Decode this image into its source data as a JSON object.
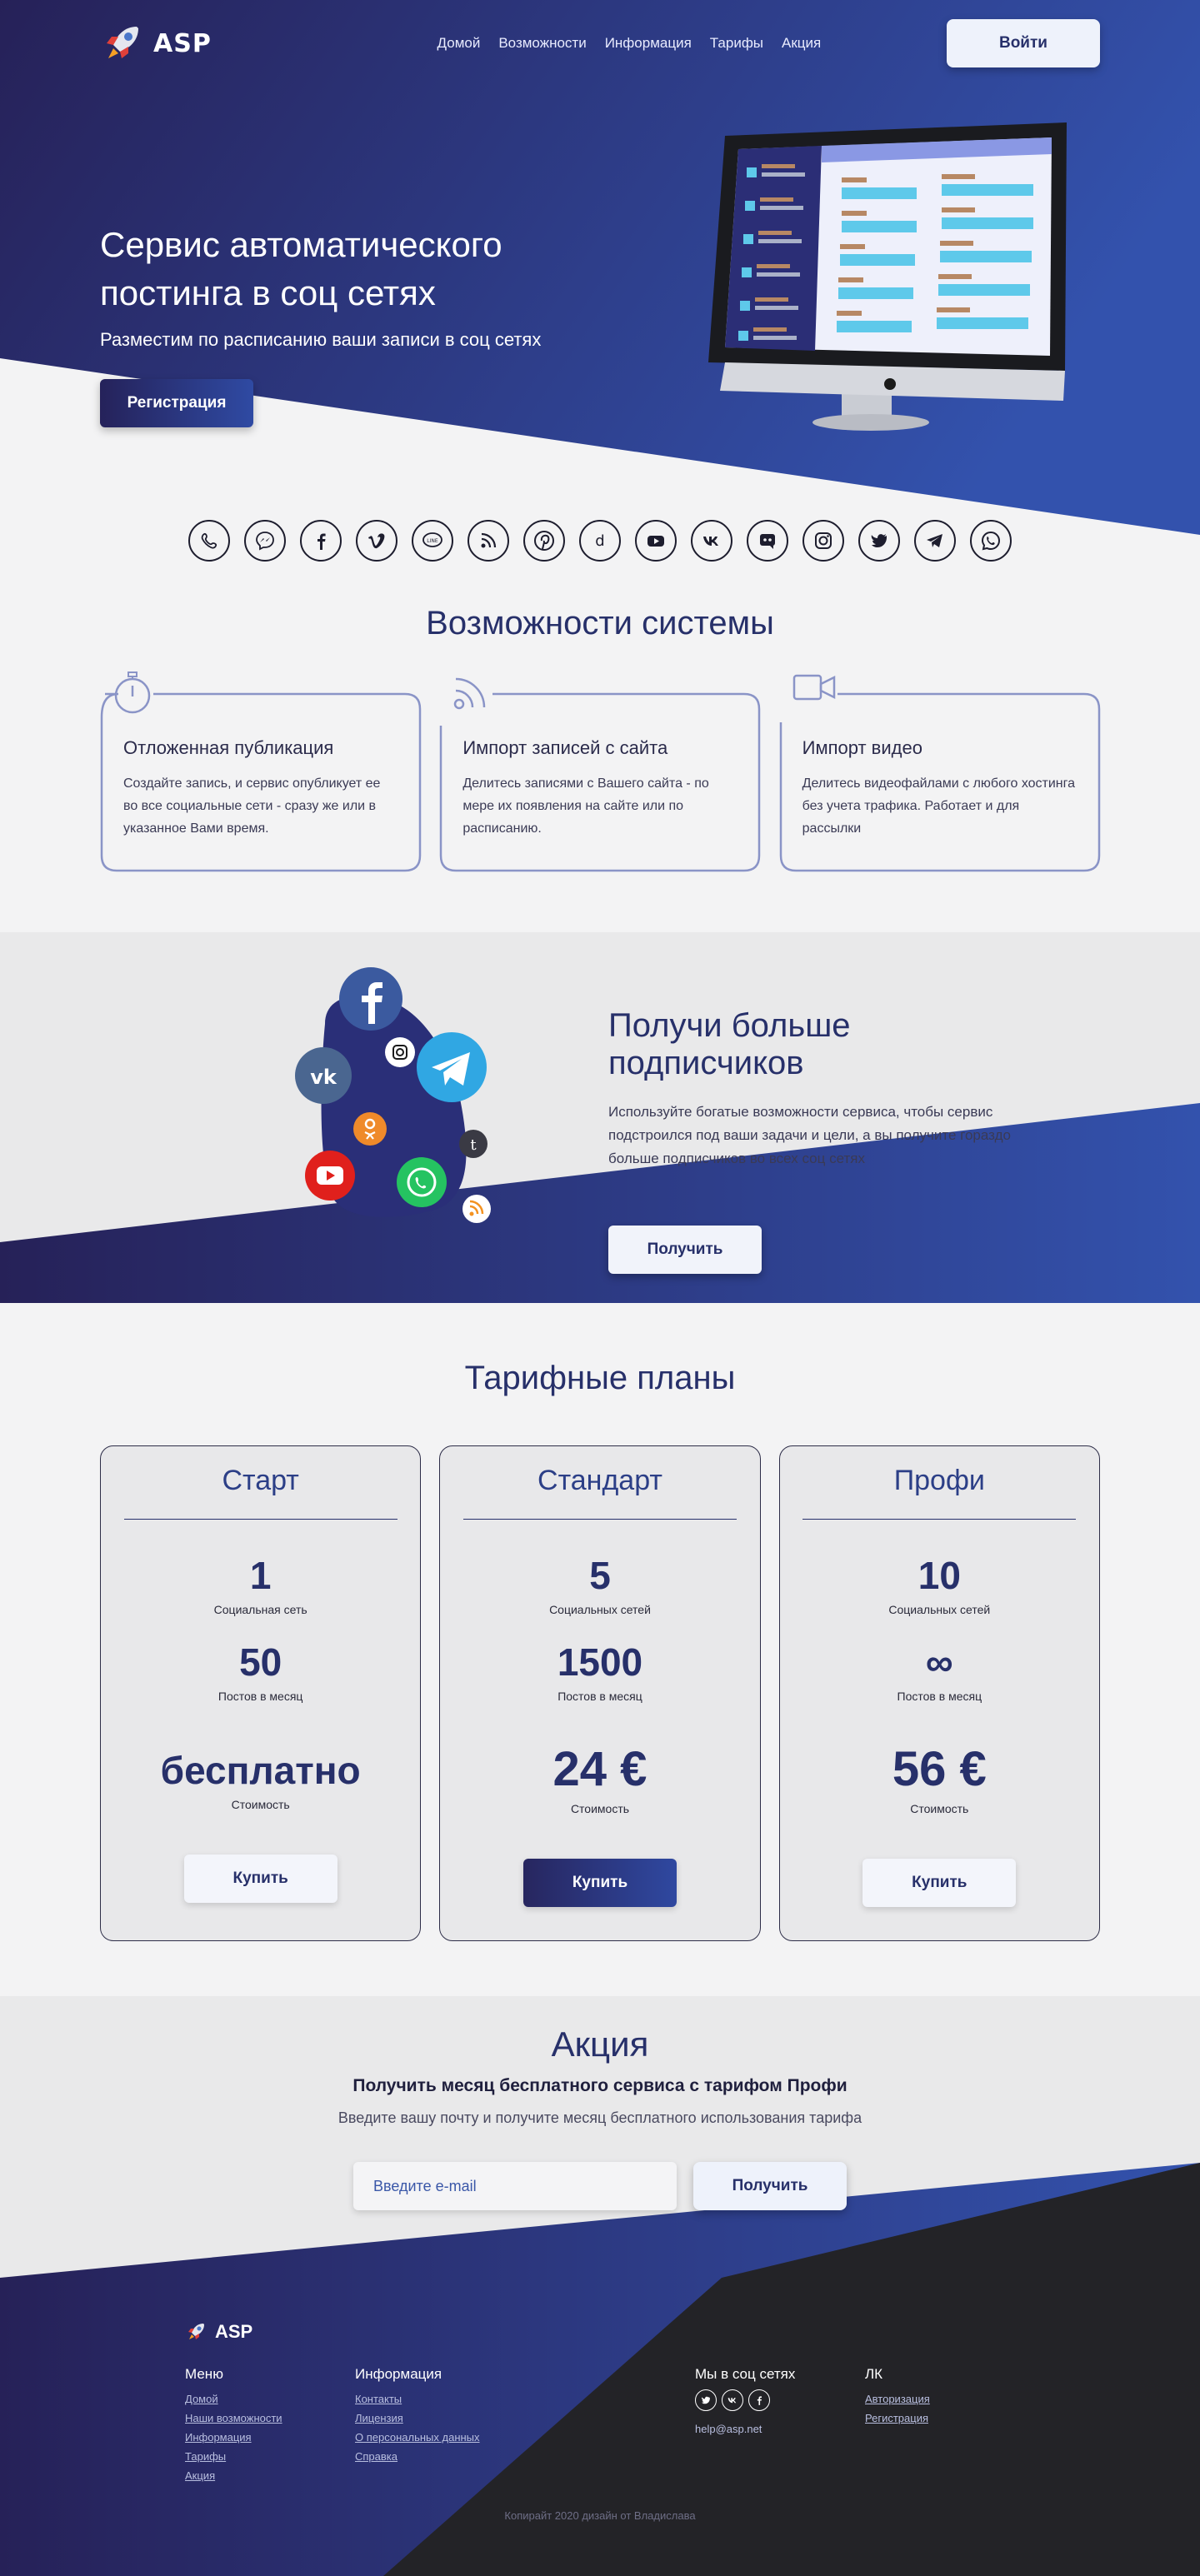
{
  "brand": {
    "name": "ASP"
  },
  "nav": {
    "items": [
      "Домой",
      "Возможности",
      "Информация",
      "Тарифы",
      "Акция"
    ]
  },
  "header": {
    "login_label": "Войти"
  },
  "hero": {
    "title_line1": "Сервис автоматического",
    "title_line2": "постинга в соц сетях",
    "subtitle": "Разместим по расписанию ваши записи в соц сетях",
    "cta_label": "Регистрация"
  },
  "social_icons": [
    "viber-icon",
    "messenger-icon",
    "facebook-icon",
    "vimeo-icon",
    "line-icon",
    "rss-icon",
    "pinterest-icon",
    "dailymotion-icon",
    "youtube-icon",
    "vk-icon",
    "discord-icon",
    "instagram-icon",
    "twitter-icon",
    "telegram-icon",
    "whatsapp-icon"
  ],
  "features": {
    "title": "Возможности системы",
    "items": [
      {
        "icon": "stopwatch-icon",
        "title": "Отложенная публикация",
        "text": "Создайте запись, и сервис опубликует ее во все социальные сети - сразу же или в указанное Вами время."
      },
      {
        "icon": "rss-icon",
        "title": "Импорт записей с сайта",
        "text": "Делитесь записями с Вашего сайта - по мере их появления на сайте или по расписанию."
      },
      {
        "icon": "video-camera-icon",
        "title": "Импорт видео",
        "text": "Делитесь видеофайлами с любого хостинга без учета трафика. Работает и для рассылки"
      }
    ]
  },
  "subscribers": {
    "title": "Получи больше подписчиков",
    "text": "Используйте богатые возможности сервиса, чтобы сервис подстроился под ваши задачи и цели, а вы получите гораздо больше подписчиков во всех соц сетях",
    "cta_label": "Получить"
  },
  "pricing": {
    "title": "Тарифные планы",
    "plans": [
      {
        "name": "Старт",
        "networks": "1",
        "networks_label": "Социальная сеть",
        "posts": "50",
        "posts_label": "Постов в месяц",
        "price": "бесплатно",
        "price_label": "Стоимость",
        "buy_label": "Купить"
      },
      {
        "name": "Стандарт",
        "networks": "5",
        "networks_label": "Социальных сетей",
        "posts": "1500",
        "posts_label": "Постов в месяц",
        "price": "24 €",
        "price_label": "Стоимость",
        "buy_label": "Купить"
      },
      {
        "name": "Профи",
        "networks": "10",
        "networks_label": "Социальных сетей",
        "posts": "∞",
        "posts_label": "Постов в месяц",
        "price": "56 €",
        "price_label": "Стоимость",
        "buy_label": "Купить"
      }
    ]
  },
  "promo": {
    "title": "Акция",
    "subtitle": "Получить месяц бесплатного сервиса с тарифом Профи",
    "desc": "Введите вашу почту и получите месяц бесплатного использования тарифа",
    "email_placeholder": "Введите e-mail",
    "cta_label": "Получить"
  },
  "footer": {
    "brand": "ASP",
    "menu": {
      "title": "Меню",
      "links": [
        "Домой",
        "Наши возможности",
        "Информация",
        "Тарифы",
        "Акция"
      ]
    },
    "info": {
      "title": "Информация",
      "links": [
        "Контакты",
        "Лицензия",
        "О персональных данных",
        "Справка"
      ]
    },
    "social": {
      "title": "Мы в соц сетях",
      "icons": [
        "twitter-icon",
        "vk-icon",
        "facebook-icon"
      ],
      "email": "help@asp.net"
    },
    "account": {
      "title": "ЛК",
      "links": [
        "Авторизация",
        "Регистрация"
      ]
    },
    "copyright": "Копирайт 2020 дизайн от Владислава"
  },
  "colors": {
    "primary": "#27306a",
    "gradient_start": "#262158",
    "gradient_end": "#3352ad",
    "background": "#f3f3f4",
    "dark_footer": "#232327"
  }
}
